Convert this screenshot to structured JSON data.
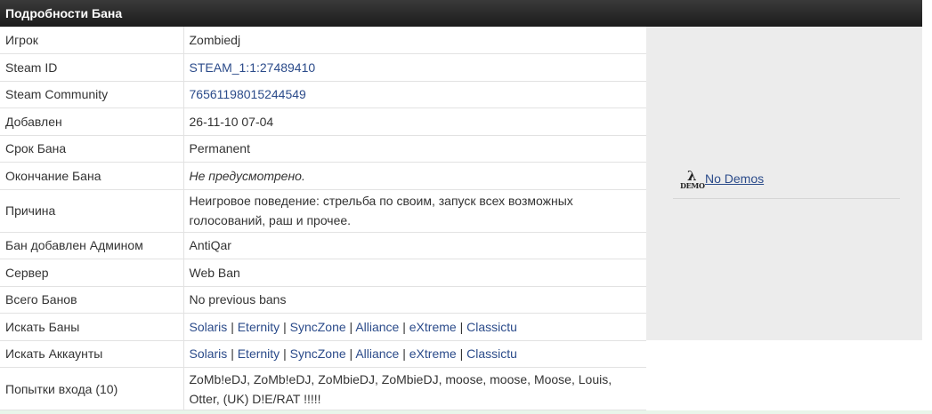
{
  "header": {
    "title": "Подробности Бана"
  },
  "rows": [
    {
      "label": "Игрок",
      "value": "Zombiedj"
    },
    {
      "label": "Steam ID",
      "value": "STEAM_1:1:27489410"
    },
    {
      "label": "Steam Community",
      "value": "76561198015244549"
    },
    {
      "label": "Добавлен",
      "value": "26-11-10 07-04"
    },
    {
      "label": "Срок Бана",
      "value": "Permanent"
    },
    {
      "label": "Окончание Бана",
      "value": "Не предусмотрено."
    },
    {
      "label": "Причина",
      "value": "Неигровое поведение: стрельба по своим, запуск всех возможных голосований, раш и прочее."
    },
    {
      "label": "Бан добавлен Админом",
      "value": "AntiQar"
    },
    {
      "label": "Сервер",
      "value": "Web Ban"
    },
    {
      "label": "Всего Банов",
      "value": "No previous bans"
    },
    {
      "label": "Искать Баны",
      "links": [
        "Solaris",
        "Eternity",
        "SyncZone",
        "Alliance",
        "eXtreme",
        "Classictu"
      ]
    },
    {
      "label": "Искать Аккаунты",
      "links": [
        "Solaris",
        "Eternity",
        "SyncZone",
        "Alliance",
        "eXtreme",
        "Classictu"
      ]
    },
    {
      "label": "Попытки входа (10)",
      "value": "ZoMb!eDJ, ZoMb!eDJ, ZoMbieDJ, ZoMbieDJ, moose, moose, Moose, Louis, Otter, (UK) D!E/RAT !!!!!"
    }
  ],
  "demos": {
    "icon_text": "DEMO",
    "icon_symbol": "λ",
    "label": "No Demos"
  },
  "separator": "|",
  "colors": {
    "header_bg": "#2a2a2a",
    "link": "#2b4b8a",
    "side_panel_bg": "#ececec"
  }
}
